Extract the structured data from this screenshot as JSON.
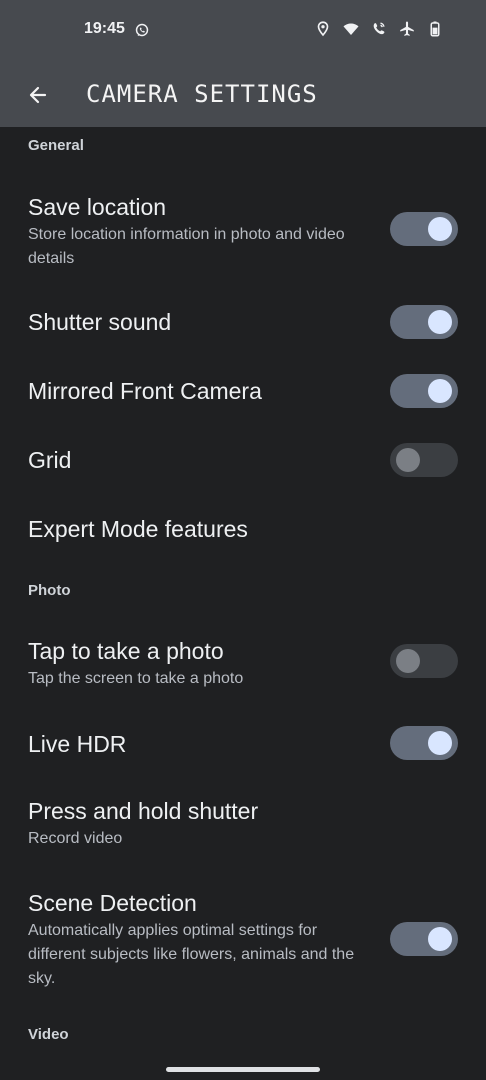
{
  "status_bar": {
    "time": "19:45"
  },
  "app_bar": {
    "title": "CAMERA SETTINGS"
  },
  "sections": {
    "general": "General",
    "photo": "Photo",
    "video": "Video"
  },
  "settings": {
    "save_location": {
      "title": "Save location",
      "subtitle": "Store location information in photo and video details",
      "enabled": true
    },
    "shutter_sound": {
      "title": "Shutter sound",
      "enabled": true
    },
    "mirrored_front_camera": {
      "title": "Mirrored Front Camera",
      "enabled": true
    },
    "grid": {
      "title": "Grid",
      "enabled": false
    },
    "expert_mode": {
      "title": "Expert Mode features"
    },
    "tap_to_take_photo": {
      "title": "Tap to take a photo",
      "subtitle": "Tap the screen to take a photo",
      "enabled": false
    },
    "live_hdr": {
      "title": "Live HDR",
      "enabled": true
    },
    "press_hold_shutter": {
      "title": "Press and hold shutter",
      "subtitle": "Record video"
    },
    "scene_detection": {
      "title": "Scene Detection",
      "subtitle": "Automatically applies optimal settings for different subjects like flowers, animals and the sky.",
      "enabled": true
    }
  },
  "icons": {
    "back": "arrow-left-icon",
    "whatsapp": "whatsapp-icon",
    "location": "location-pin-icon",
    "wifi": "wifi-icon",
    "wifi_calling": "wifi-calling-icon",
    "airplane": "airplane-icon",
    "battery": "battery-icon"
  },
  "colors": {
    "background": "#1f2022",
    "top_chrome": "#474a4f",
    "switch_on_track": "#646d7c",
    "switch_on_thumb": "#d9e6ff",
    "switch_off_track": "#3b3e42",
    "switch_off_thumb": "#7b7f85"
  }
}
